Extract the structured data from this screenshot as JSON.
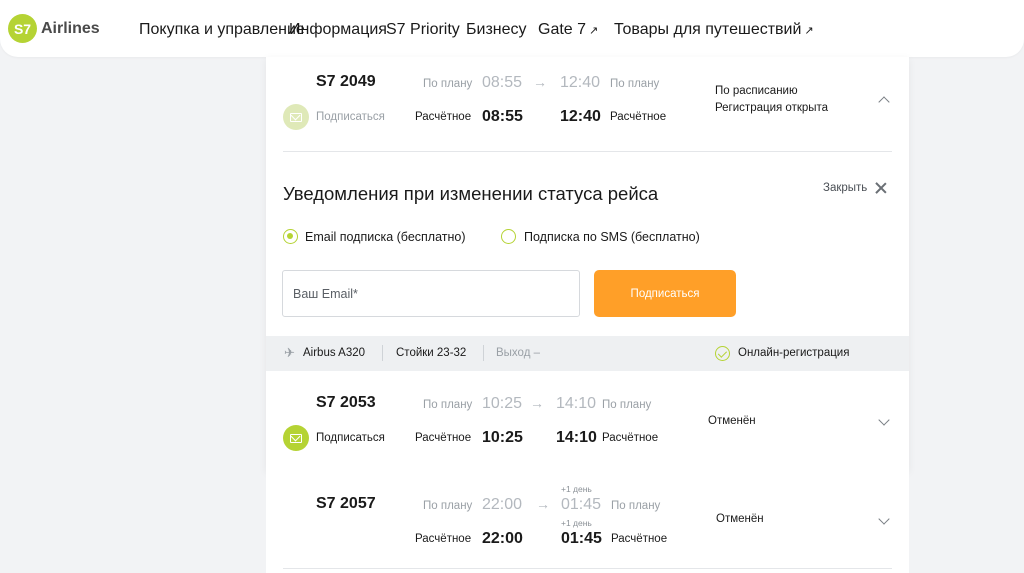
{
  "brand": {
    "badge": "S7",
    "name": "Airlines",
    "color": "#b5d334"
  },
  "nav": [
    {
      "label": "Покупка и управление"
    },
    {
      "label": "Информация"
    },
    {
      "label": "S7 Priority"
    },
    {
      "label": "Бизнесу"
    },
    {
      "label": "Gate 7",
      "external": true
    },
    {
      "label": "Товары для путешествий",
      "external": true
    }
  ],
  "ext_arrow": "↗",
  "flights": [
    {
      "number": "S7 2049",
      "planned_label": "По плану",
      "planned_dep": "08:55",
      "planned_arr": "12:40",
      "estimated_label": "Расчётное",
      "estimated_dep": "08:55",
      "estimated_arr": "12:40",
      "subscribe_label": "Подписаться",
      "status_line1": "По расписанию",
      "status_line2": "Регистрация открыта",
      "expanded": true
    },
    {
      "number": "S7 2053",
      "planned_label": "По плану",
      "planned_dep": "10:25",
      "planned_arr": "14:10",
      "estimated_label": "Расчётное",
      "estimated_dep": "10:25",
      "estimated_arr": "14:10",
      "subscribe_label": "Подписаться",
      "status_line1": "Отменён",
      "expanded": false
    },
    {
      "number": "S7 2057",
      "planned_label": "По плану",
      "planned_dep": "22:00",
      "planned_arr": "01:45",
      "plus_day": "+1 день",
      "estimated_label": "Расчётное",
      "estimated_dep": "22:00",
      "estimated_arr": "01:45",
      "status_line1": "Отменён",
      "expanded": false
    }
  ],
  "arrow_glyph": "→",
  "notifications": {
    "title": "Уведомления при изменении статуса рейса",
    "close_label": "Закрыть",
    "options": [
      {
        "label": "Email подписка (бесплатно)",
        "checked": true
      },
      {
        "label": "Подписка по SMS (бесплатно)",
        "checked": false
      }
    ],
    "email_placeholder": "Ваш Email*",
    "email_value": "",
    "submit_label": "Подписаться",
    "submit_color": "#ff9f28"
  },
  "info_bar": {
    "aircraft": "Airbus A320",
    "counters": "Стойки 23-32",
    "gate": "Выход –",
    "online_checkin": "Онлайн-регистрация"
  }
}
